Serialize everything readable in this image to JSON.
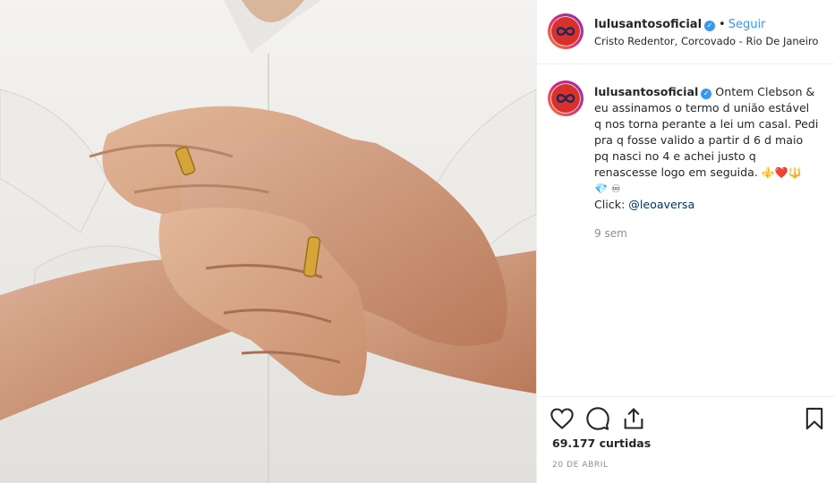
{
  "post": {
    "image_alt": "Photo of two pairs of hands with gold rings on white shirts",
    "header": {
      "username": "lulusantosoficial",
      "verified_icon": "verified-badge-icon",
      "separator": "•",
      "follow_label": "Seguir",
      "location": "Cristo Redentor, Corcovado - Rio De Janeiro"
    },
    "caption": {
      "username": "lulusantosoficial",
      "text": "Ontem Clebson & eu assinamos o termo d união estável q nos torna perante a lei um casal. Pedi pra q fosse valido a partir d 6 d maio pq nasci no 4 e achei justo q renascesse logo em seguida.",
      "emojis_line1": "⚜️❤️🔱",
      "emojis_line2": "💎 ♾",
      "credit_prefix": "Click:",
      "credit_mention": "@leoaversa",
      "time_ago": "9 sem"
    },
    "actions": {
      "like_icon": "heart-icon",
      "comment_icon": "comment-icon",
      "share_icon": "share-icon",
      "save_icon": "bookmark-icon",
      "likes": "69.177 curtidas",
      "date": "20 DE ABRIL"
    },
    "colors": {
      "accent": "#3897f0",
      "avatar_red": "#d9302c",
      "muted": "#8e8e8e"
    }
  }
}
